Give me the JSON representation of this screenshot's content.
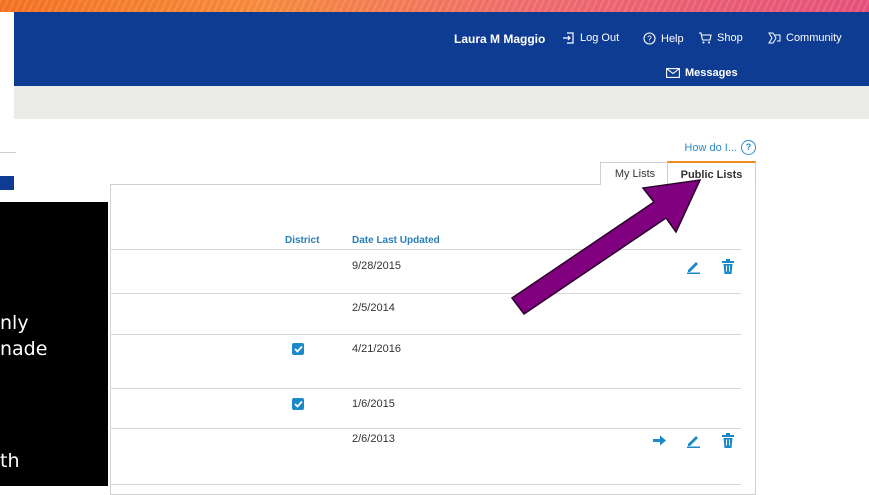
{
  "header": {
    "user_name": "Laura M Maggio",
    "logout_label": "Log Out",
    "help_label": "Help",
    "shop_label": "Shop",
    "community_label": "Community",
    "messages_label": "Messages"
  },
  "colors": {
    "header_bg": "#0f3c93",
    "accent_orange": "#f08a24",
    "link_blue": "#2e8ac8",
    "arrow_purple": "#800080"
  },
  "help_link": {
    "label": "How do I...",
    "icon": "?"
  },
  "tabs": [
    {
      "label": "My Lists",
      "active": false
    },
    {
      "label": "Public Lists",
      "active": true
    }
  ],
  "table": {
    "columns": {
      "district": "District",
      "date": "Date Last Updated"
    },
    "rows": [
      {
        "district": false,
        "date": "9/28/2015",
        "actions": [
          "edit-icon",
          "trash-icon"
        ]
      },
      {
        "district": false,
        "date": "2/5/2014",
        "actions": []
      },
      {
        "district": true,
        "date": "4/21/2016",
        "actions": []
      },
      {
        "district": true,
        "date": "1/6/2015",
        "actions": []
      },
      {
        "district": false,
        "date": "2/6/2013",
        "actions": [
          "arrow-right-icon",
          "edit-icon",
          "trash-icon"
        ]
      }
    ]
  },
  "overlay": {
    "text_lines": [
      "nly",
      "nade",
      "th"
    ]
  }
}
